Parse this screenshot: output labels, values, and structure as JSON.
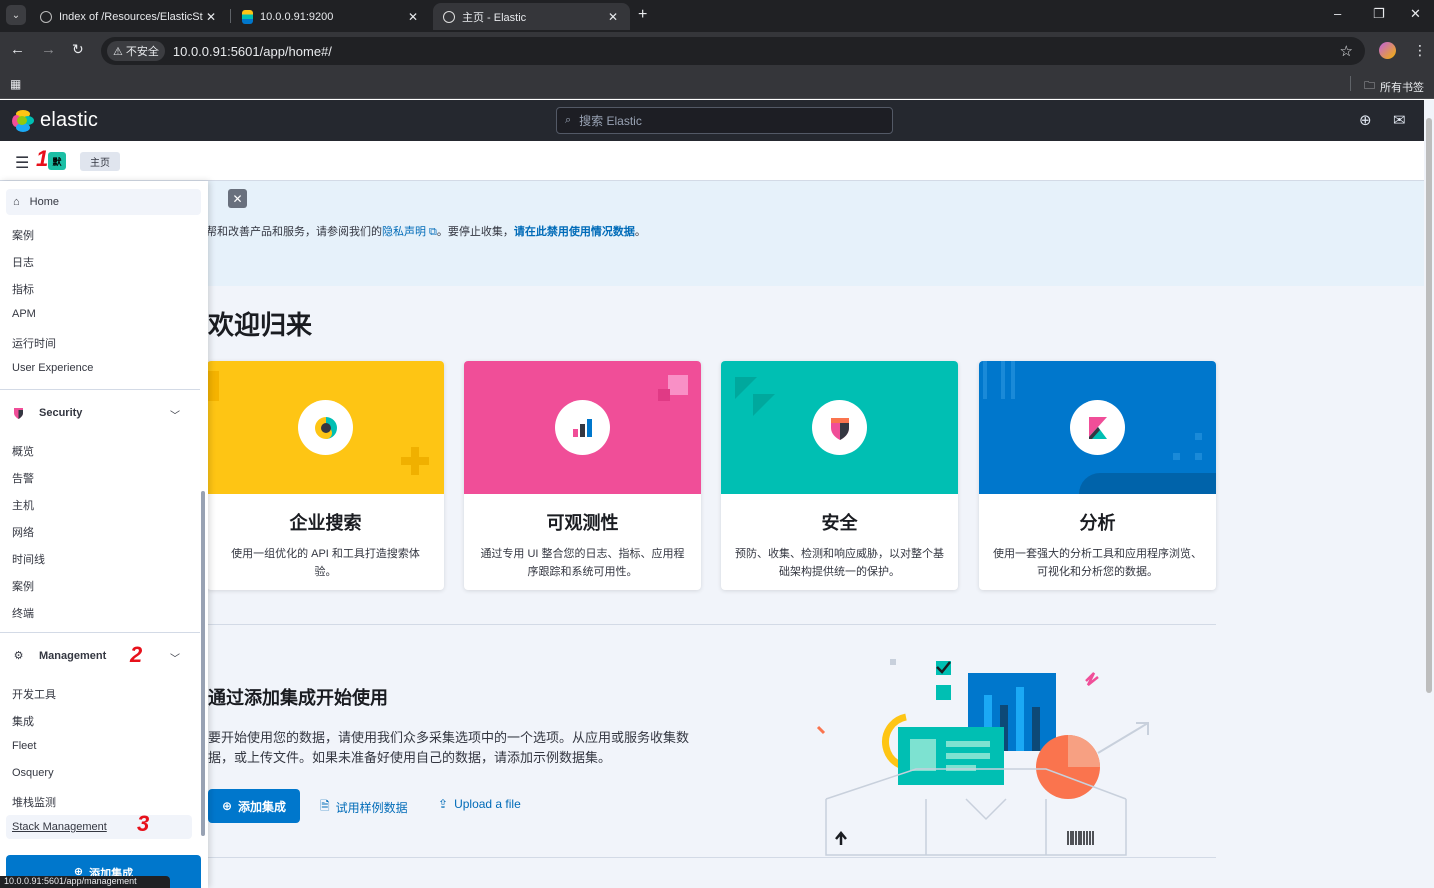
{
  "browser": {
    "tabs": [
      {
        "title": "Index of /Resources/ElasticSt",
        "favicon": "globe-icon"
      },
      {
        "title": "10.0.0.91:9200",
        "favicon": "elastic-icon"
      },
      {
        "title": "主页 - Elastic",
        "favicon": "globe-icon",
        "active": true
      }
    ],
    "security_chip": "不安全",
    "url": "10.0.0.91:5601/app/home#/",
    "bookmarks_all": "所有书签",
    "status_url": "10.0.0.91:5601/app/management"
  },
  "kibana": {
    "brand": "elastic",
    "search_placeholder": "搜索 Elastic",
    "space_initial": "默",
    "breadcrumb": "主页"
  },
  "sidenav": {
    "home_label": "Home",
    "observability_items": [
      "案例",
      "日志",
      "指标",
      "APM",
      "运行时间",
      "User Experience"
    ],
    "security_group": "Security",
    "security_items": [
      "概览",
      "告警",
      "主机",
      "网络",
      "时间线",
      "案例",
      "终端"
    ],
    "management_group": "Management",
    "management_items": [
      "开发工具",
      "集成",
      "Fleet",
      "Osquery",
      "堆栈监测"
    ],
    "stack_management": "Stack Management",
    "add_integrations": "添加集成"
  },
  "annotations": [
    "1",
    "2",
    "3"
  ],
  "notice": {
    "text_before": "帮和改善产品和服务，请参阅我们的",
    "privacy_link": "隐私声明",
    "text_middle": "。要停止收集，",
    "disable_link": "请在此禁用使用情况数据",
    "text_end": "。"
  },
  "main": {
    "welcome": "欢迎归来",
    "solutions": [
      {
        "title": "企业搜索",
        "desc": "使用一组优化的 API 和工具打造搜索体验。",
        "color": "#fec514"
      },
      {
        "title": "可观测性",
        "desc": "通过专用 UI 整合您的日志、指标、应用程序跟踪和系统可用性。",
        "color": "#f04e98"
      },
      {
        "title": "安全",
        "desc": "预防、收集、检测和响应威胁，以对整个基础架构提供统一的保护。",
        "color": "#00bfb3"
      },
      {
        "title": "分析",
        "desc": "使用一套强大的分析工具和应用程序浏览、可视化和分析您的数据。",
        "color": "#0077cc"
      }
    ],
    "integrations_title": "通过添加集成开始使用",
    "integrations_desc": "要开始使用您的数据，请使用我们众多采集选项中的一个选项。从应用或服务收集数据，或上传文件。如果未准备好使用自己的数据，请添加示例数据集。",
    "add_button": "添加集成",
    "sample_link": "试用样例数据",
    "upload_link": "Upload a file"
  }
}
